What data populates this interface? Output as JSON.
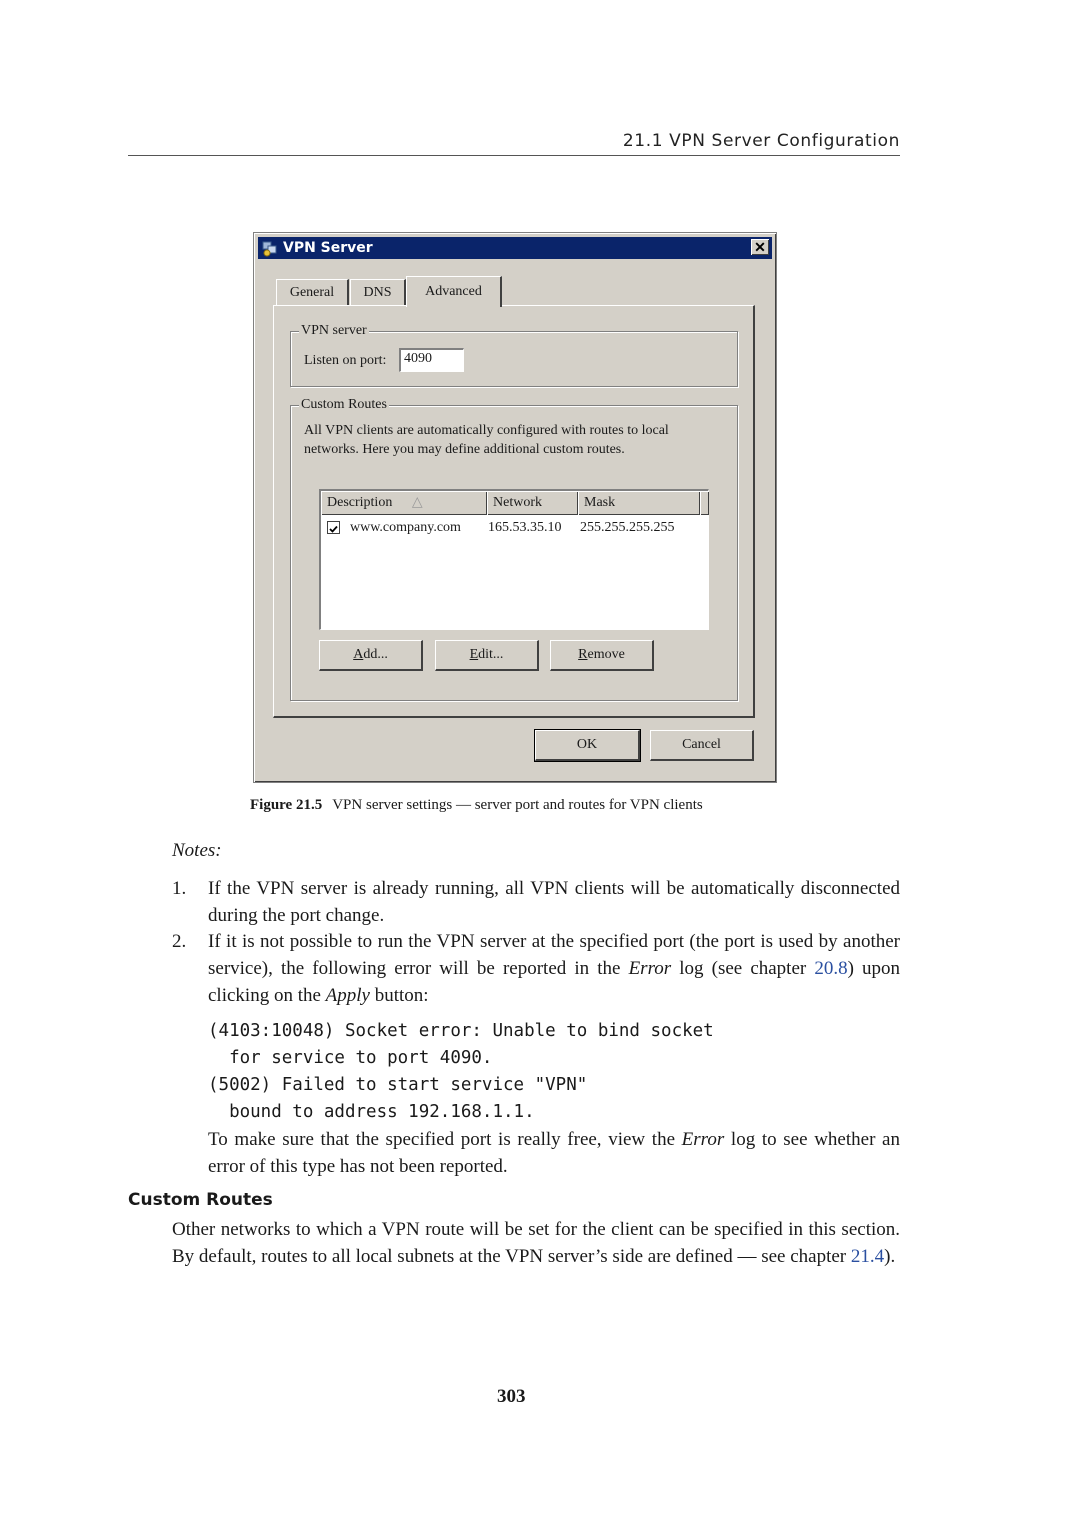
{
  "running_head": "21.1  VPN Server Configuration",
  "dialog": {
    "title": "VPN Server",
    "app_icon": "vpn-server-icon",
    "close_icon": "close-icon",
    "close_glyph": "✕",
    "tabs": [
      {
        "label": "General",
        "active": false
      },
      {
        "label": "DNS",
        "active": false
      },
      {
        "label": "Advanced",
        "active": true
      }
    ],
    "vpn_server_group": {
      "legend": "VPN server",
      "port_label": "Listen on port:",
      "port_value": "4090"
    },
    "custom_routes_group": {
      "legend": "Custom Routes",
      "description_line1": "All VPN clients are automatically configured with routes to local",
      "description_line2": "networks. Here you may define additional custom routes.",
      "columns": [
        "Description",
        "Network",
        "Mask"
      ],
      "sort_indicator": "△",
      "rows": [
        {
          "checked": true,
          "description": "www.company.com",
          "network": "165.53.35.10",
          "mask": "255.255.255.255"
        }
      ],
      "buttons": {
        "add": {
          "mnemonic": "A",
          "rest": "dd..."
        },
        "edit": {
          "mnemonic": "E",
          "rest": "dit..."
        },
        "remove": {
          "mnemonic": "R",
          "rest": "emove"
        }
      }
    },
    "ok_label": "OK",
    "cancel_label": "Cancel"
  },
  "figure_caption": {
    "label": "Figure 21.5",
    "text": "VPN server settings — server port and routes for VPN clients"
  },
  "notes": {
    "heading": "Notes:",
    "items": [
      {
        "number": "1.",
        "text": "If the VPN server is already running, all VPN clients will be automatically disconnected during the port change."
      },
      {
        "number": "2.",
        "text_before_error": "If it is not possible to run the VPN server at the specified port (the port is used by another service), the following error will be reported in the ",
        "error_word": "Error",
        "text_log_see": " log (see chapter ",
        "chapter_link": "20.8",
        "text_upon": ") upon clicking on the ",
        "apply_word": "Apply",
        "text_button": " button:"
      }
    ],
    "code_lines": [
      "(4103:10048) Socket error: Unable to bind socket",
      "  for service to port 4090.",
      "(5002) Failed to start service \"VPN\"",
      "  bound to address 192.168.1.1."
    ],
    "followup_before": "To make sure that the specified port is really free, view the ",
    "followup_error": "Error",
    "followup_after": " log to see whether an error of this type has not been reported."
  },
  "section": {
    "heading": "Custom Routes",
    "text_before": "Other networks to which a VPN route will be set for the client can be specified in this section.  By default, routes to all local subnets at the VPN server’s side are defined — see chapter ",
    "chapter_link": "21.4",
    "text_after": ")."
  },
  "page_number": "303"
}
